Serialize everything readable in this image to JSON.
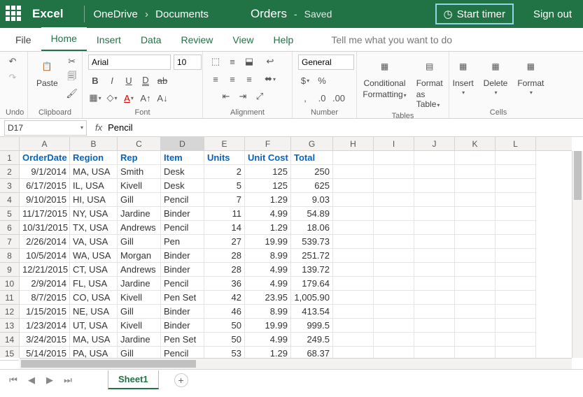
{
  "titlebar": {
    "app": "Excel",
    "path1": "OneDrive",
    "path2": "Documents",
    "doc": "Orders",
    "dash": "-",
    "state": "Saved",
    "timer": "Start timer",
    "signout": "Sign out"
  },
  "tabs": {
    "file": "File",
    "home": "Home",
    "insert": "Insert",
    "data": "Data",
    "review": "Review",
    "view": "View",
    "help": "Help",
    "tellme": "Tell me what you want to do"
  },
  "ribbon": {
    "undo": "Undo",
    "paste": "Paste",
    "clipboard": "Clipboard",
    "font_name": "Arial",
    "font_size": "10",
    "font": "Font",
    "alignment": "Alignment",
    "number_format": "General",
    "number": "Number",
    "cond_fmt1": "Conditional",
    "cond_fmt2": "Formatting",
    "fmt_tbl1": "Format",
    "fmt_tbl2": "as Table",
    "tables": "Tables",
    "insert": "Insert",
    "delete": "Delete",
    "format": "Format",
    "cells": "Cells"
  },
  "fx": {
    "cell_ref": "D17",
    "formula": "Pencil"
  },
  "columns": [
    "A",
    "B",
    "C",
    "D",
    "E",
    "F",
    "G",
    "H",
    "I",
    "J",
    "K",
    "L"
  ],
  "selected_col": "D",
  "row_count": 15,
  "headers": [
    "OrderDate",
    "Region",
    "Rep",
    "Item",
    "Units",
    "Unit Cost",
    "Total"
  ],
  "rows": [
    [
      "9/1/2014",
      "MA, USA",
      "Smith",
      "Desk",
      "2",
      "125",
      "250"
    ],
    [
      "6/17/2015",
      "IL, USA",
      "Kivell",
      "Desk",
      "5",
      "125",
      "625"
    ],
    [
      "9/10/2015",
      "HI, USA",
      "Gill",
      "Pencil",
      "7",
      "1.29",
      "9.03"
    ],
    [
      "11/17/2015",
      "NY, USA",
      "Jardine",
      "Binder",
      "11",
      "4.99",
      "54.89"
    ],
    [
      "10/31/2015",
      "TX, USA",
      "Andrews",
      "Pencil",
      "14",
      "1.29",
      "18.06"
    ],
    [
      "2/26/2014",
      "VA, USA",
      "Gill",
      "Pen",
      "27",
      "19.99",
      "539.73"
    ],
    [
      "10/5/2014",
      "WA, USA",
      "Morgan",
      "Binder",
      "28",
      "8.99",
      "251.72"
    ],
    [
      "12/21/2015",
      "CT, USA",
      "Andrews",
      "Binder",
      "28",
      "4.99",
      "139.72"
    ],
    [
      "2/9/2014",
      "FL, USA",
      "Jardine",
      "Pencil",
      "36",
      "4.99",
      "179.64"
    ],
    [
      "8/7/2015",
      "CO, USA",
      "Kivell",
      "Pen Set",
      "42",
      "23.95",
      "1,005.90"
    ],
    [
      "1/15/2015",
      "NE, USA",
      "Gill",
      "Binder",
      "46",
      "8.99",
      "413.54"
    ],
    [
      "1/23/2014",
      "UT, USA",
      "Kivell",
      "Binder",
      "50",
      "19.99",
      "999.5"
    ],
    [
      "3/24/2015",
      "MA, USA",
      "Jardine",
      "Pen Set",
      "50",
      "4.99",
      "249.5"
    ],
    [
      "5/14/2015",
      "PA, USA",
      "Gill",
      "Pencil",
      "53",
      "1.29",
      "68.37"
    ]
  ],
  "sheet": {
    "name": "Sheet1"
  }
}
